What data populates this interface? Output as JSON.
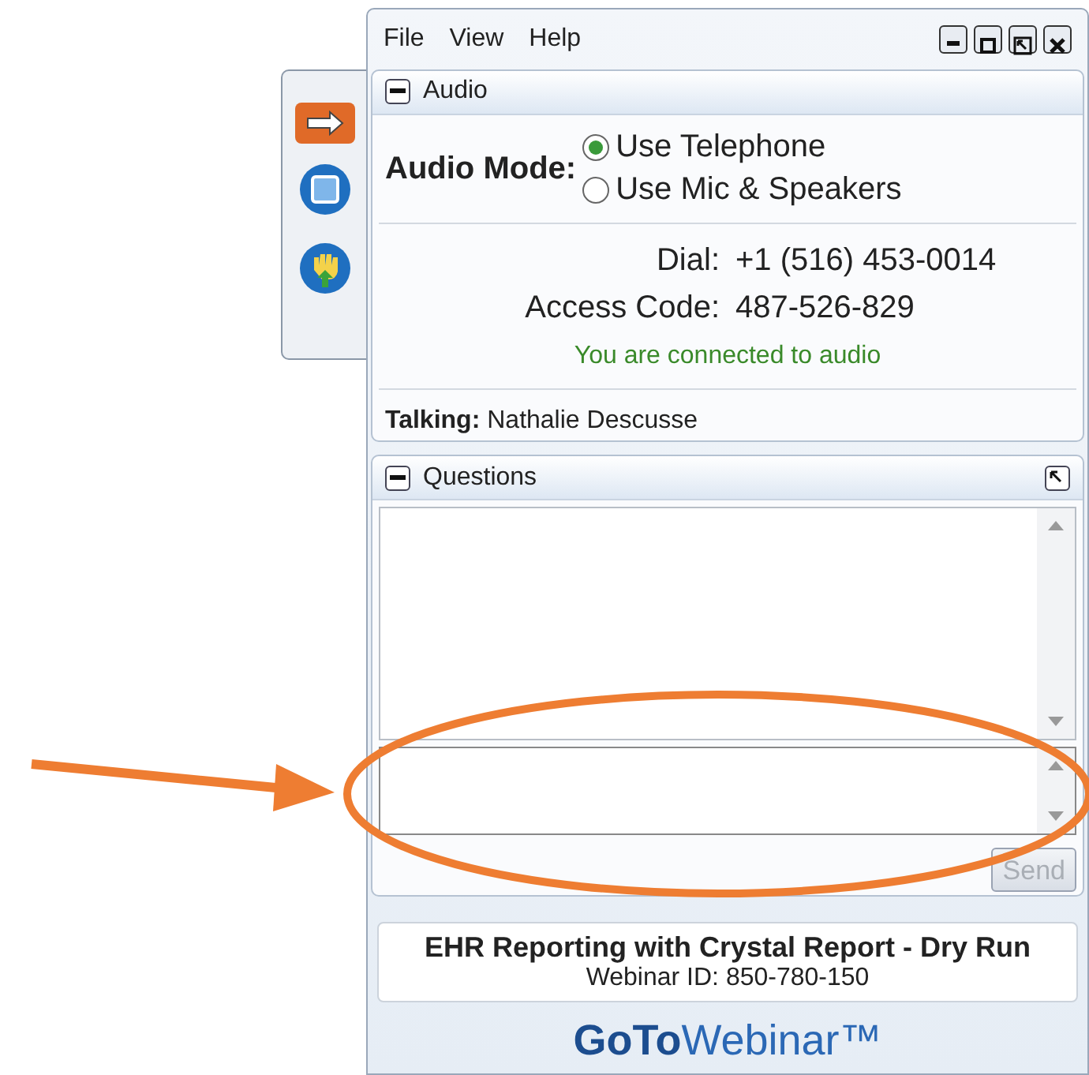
{
  "menu": [
    "File",
    "View",
    "Help"
  ],
  "audio": {
    "title": "Audio",
    "mode_label": "Audio Mode:",
    "options": [
      {
        "label": "Use Telephone",
        "selected": true
      },
      {
        "label": "Use Mic & Speakers",
        "selected": false
      }
    ],
    "dial_label": "Dial:",
    "dial": "+1 (516) 453-0014",
    "code_label": "Access Code:",
    "code": "487-526-829",
    "status": "You are connected to audio",
    "talking_label": "Talking:",
    "talking": "Nathalie Descusse"
  },
  "questions": {
    "title": "Questions",
    "send": {
      "label": "Send",
      "disabled": true
    }
  },
  "webinar": {
    "title": "EHR Reporting with Crystal Report - Dry Run",
    "id": "Webinar ID: 850-780-150"
  },
  "logo": "**GoTo**Webinar™"
}
